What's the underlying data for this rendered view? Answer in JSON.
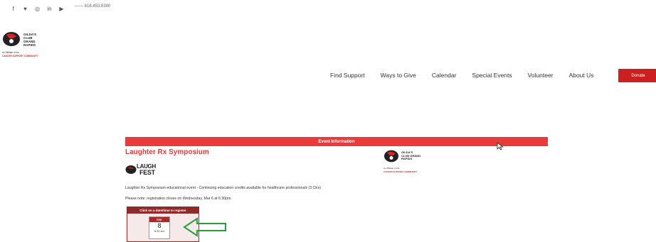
{
  "social": {
    "icons": [
      "facebook-icon",
      "twitter-icon",
      "instagram-icon",
      "linkedin-icon",
      "youtube-icon"
    ],
    "glyphs": [
      "f",
      "♥",
      "◎",
      "in",
      "▶"
    ],
    "phone": "—— 616.453.8300"
  },
  "logo": {
    "line1": "GILDA'S CLUB GRAND RAPIDS",
    "line2": "An Affiliate of the",
    "line3": "CANCER SUPPORT COMMUNITY"
  },
  "nav": {
    "items": [
      "Find Support",
      "Ways to Give",
      "Calendar",
      "Special Events",
      "Volunteer",
      "About Us"
    ],
    "donate": "Donate"
  },
  "event": {
    "banner": "Event Information",
    "title": "Laughter Rx Symposium",
    "laughfest_top": "LAUGH",
    "laughfest_bottom": "FEST",
    "description": "Laughter Rx Symposium educational event - Continuing education credits available for healthcare professionals (3 CEs)",
    "note": "Please note: registration closes on Wednesday, Mar 6 at 6:30pm.",
    "register_header": "Click on a date/time to register",
    "cal_month": "Mar",
    "cal_day": "8",
    "cal_time": "8:30 am"
  },
  "colors": {
    "brand_red": "#e93b3b",
    "donate_red": "#cc1f1f",
    "dark_red": "#8e2a2a",
    "arrow_green": "#2e9b3a"
  }
}
